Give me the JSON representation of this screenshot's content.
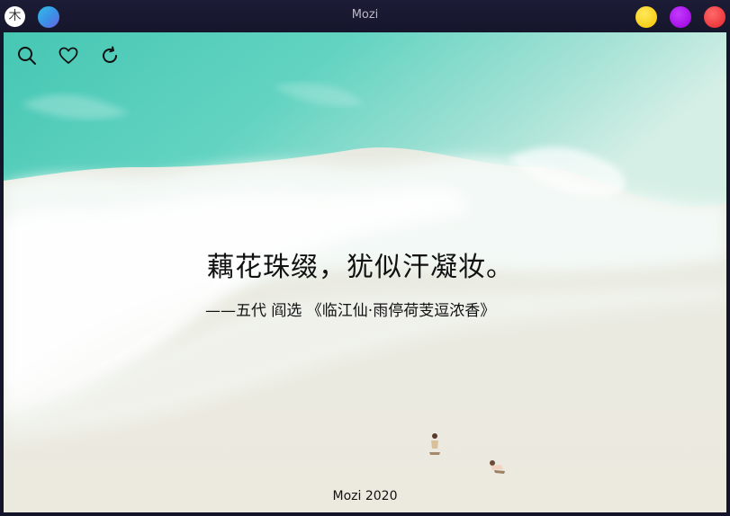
{
  "window": {
    "title": "Mozi",
    "logo_char": "木",
    "colors": {
      "titlebar": "#1a1a33",
      "minimize": "#f7cd00",
      "maximize": "#a600e6",
      "close": "#f2383a"
    }
  },
  "toolbar": {
    "icons": [
      "search-icon",
      "heart-icon",
      "refresh-icon"
    ]
  },
  "poem": {
    "line": "藕花珠缀，犹似汗凝妆。",
    "source": "——五代 阎选 《临江仙·雨停荷芰逗浓香》"
  },
  "footer": {
    "text": "Mozi 2020"
  }
}
